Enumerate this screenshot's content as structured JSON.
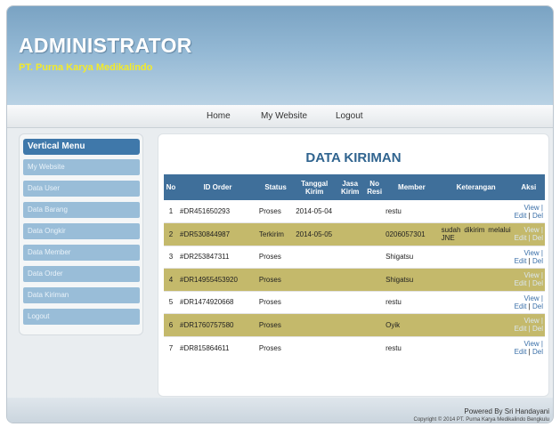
{
  "header": {
    "title": "ADMINISTRATOR",
    "subtitle": "PT. Purna Karya Medikalindo"
  },
  "nav": {
    "items": [
      "Home",
      "My Website",
      "Logout"
    ]
  },
  "sidebar": {
    "title": "Vertical Menu",
    "items": [
      "My Website",
      "Data User",
      "Data Barang",
      "Data Ongkir",
      "Data Member",
      "Data Order",
      "Data Kiriman",
      "Logout"
    ]
  },
  "main": {
    "title": "DATA KIRIMAN",
    "columns": [
      "No",
      "ID Order",
      "Status",
      "Tanggal Kirim",
      "Jasa Kirim",
      "No Resi",
      "Member",
      "Keterangan",
      "Aksi"
    ],
    "rows": [
      {
        "no": "1",
        "id_order": "#DR451650293",
        "status": "Proses",
        "tanggal": "2014-05-04",
        "jasa": "",
        "resi": "",
        "member": "restu",
        "keterangan": ""
      },
      {
        "no": "2",
        "id_order": "#DR530844987",
        "status": "Terkirim",
        "tanggal": "2014-05-05",
        "jasa": "",
        "resi": "",
        "member": "0206057301",
        "keterangan": "sudah dikirim melalui JNE"
      },
      {
        "no": "3",
        "id_order": "#DR253847311",
        "status": "Proses",
        "tanggal": "",
        "jasa": "",
        "resi": "",
        "member": "Shigatsu",
        "keterangan": ""
      },
      {
        "no": "4",
        "id_order": "#DR14955453920",
        "status": "Proses",
        "tanggal": "",
        "jasa": "",
        "resi": "",
        "member": "Shigatsu",
        "keterangan": ""
      },
      {
        "no": "5",
        "id_order": "#DR1474920668",
        "status": "Proses",
        "tanggal": "",
        "jasa": "",
        "resi": "",
        "member": "restu",
        "keterangan": ""
      },
      {
        "no": "6",
        "id_order": "#DR1760757580",
        "status": "Proses",
        "tanggal": "",
        "jasa": "",
        "resi": "",
        "member": "Oyik",
        "keterangan": ""
      },
      {
        "no": "7",
        "id_order": "#DR815864611",
        "status": "Proses",
        "tanggal": "",
        "jasa": "",
        "resi": "",
        "member": "restu",
        "keterangan": ""
      }
    ],
    "actions": {
      "view": "View |",
      "edit": "Edit",
      "sep": " | ",
      "del": "Del"
    }
  },
  "footer": {
    "powered": "Powered By Sri Handayani",
    "copyright": "Copyright © 2014 PT. Purna Karya Medikalindo Bengkulu"
  },
  "colors": {
    "header_top": "#7aa3c3",
    "subtitle": "#f3ea2a",
    "table_header": "#3f6f9a",
    "row_alt": "#c4b96b",
    "menu_item": "#99bdd8",
    "title_blue": "#30648f"
  }
}
